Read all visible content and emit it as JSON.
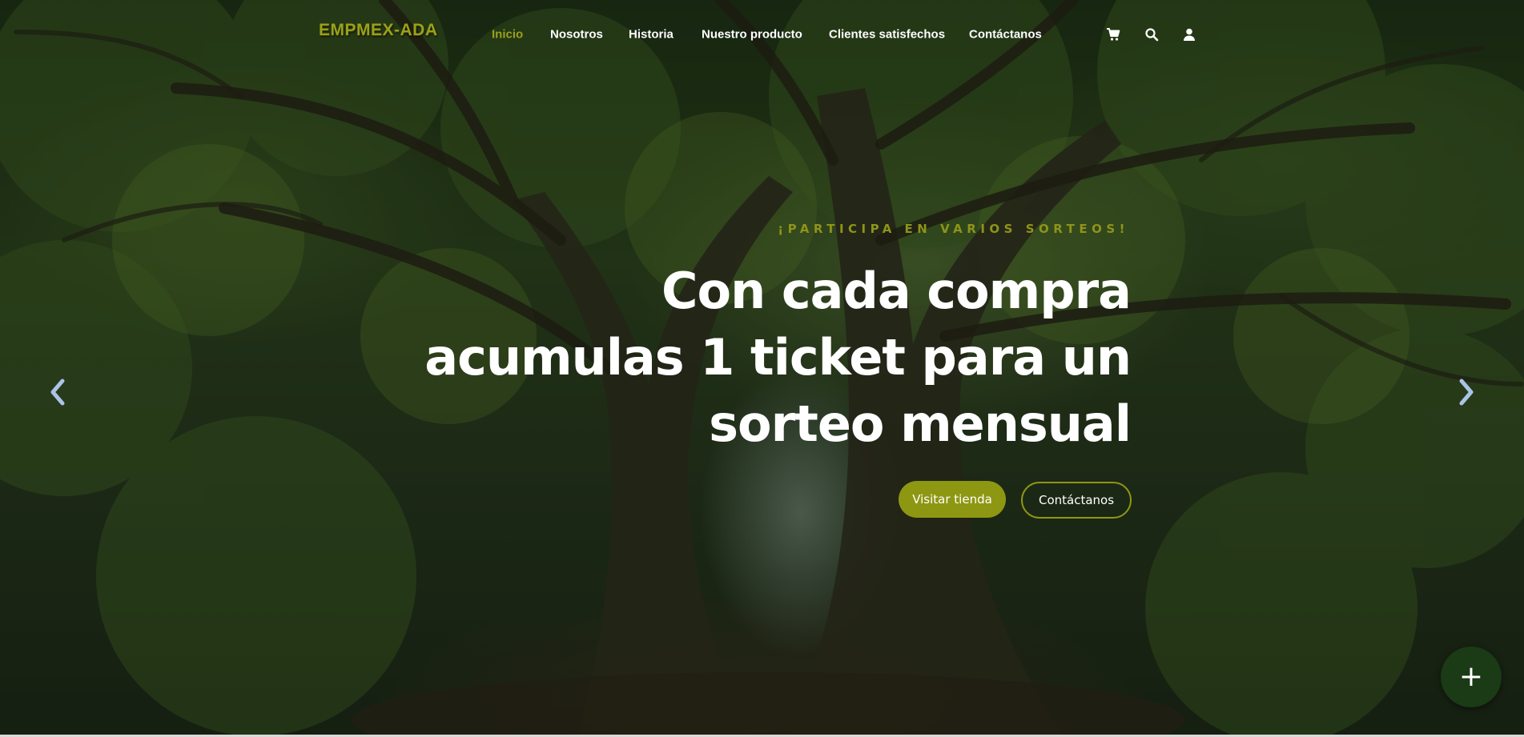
{
  "brand": {
    "logo_text": "EMPMEX-ADA"
  },
  "nav": {
    "items": [
      {
        "label": "Inicio",
        "active": true
      },
      {
        "label": "Nosotros",
        "active": false
      },
      {
        "label": "Historia",
        "active": false
      },
      {
        "label": "Nuestro producto",
        "active": false
      },
      {
        "label": "Clientes satisfechos",
        "active": false
      },
      {
        "label": "Contáctanos",
        "active": false
      }
    ],
    "icons": [
      "cart-icon",
      "search-icon",
      "user-icon"
    ]
  },
  "hero": {
    "eyebrow": "¡PARTICIPA EN VARIOS SORTEOS!",
    "headline_lines": [
      "Con cada compra",
      "acumulas 1 ticket para un",
      "sorteo mensual"
    ],
    "primary_button": "Visitar tienda",
    "secondary_button": "Contáctanos"
  },
  "carousel": {
    "prev_icon": "chevron-left-icon",
    "next_icon": "chevron-right-icon"
  },
  "fab": {
    "label": "+"
  },
  "colors": {
    "accent": "#8e9712",
    "accent_text": "#9aa11a",
    "fab_bg": "#1b3a16",
    "arrow": "#a9c4e6"
  }
}
